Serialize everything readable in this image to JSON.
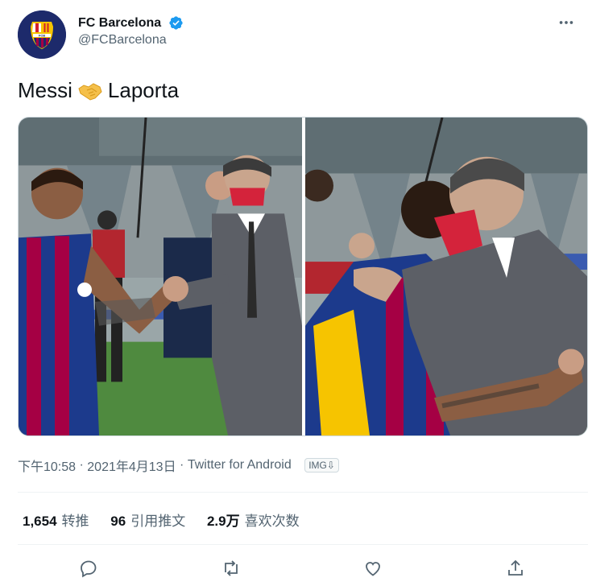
{
  "header": {
    "display_name": "FC Barcelona",
    "handle": "@FCBarcelona",
    "avatar_icon": "fc-barcelona-crest",
    "verified_icon": "verified-badge-icon",
    "more_icon": "more-horizontal-icon"
  },
  "tweet": {
    "text_before": "Messi",
    "emoji": "handshake",
    "text_after": "Laporta"
  },
  "media": {
    "photos": [
      {
        "name": "photo-handshake"
      },
      {
        "name": "photo-hug"
      }
    ]
  },
  "meta": {
    "time": "下午10:58",
    "separator1": "·",
    "date": "2021年4月13日",
    "separator2": "·",
    "source": "Twitter for Android",
    "img_badge": "IMG⇩"
  },
  "stats": [
    {
      "value": "1,654",
      "label": "转推"
    },
    {
      "value": "96",
      "label": "引用推文"
    },
    {
      "value": "2.9万",
      "label": "喜欢次数"
    }
  ],
  "actions": [
    {
      "icon": "reply-icon"
    },
    {
      "icon": "retweet-icon"
    },
    {
      "icon": "like-icon"
    },
    {
      "icon": "share-icon"
    }
  ],
  "colors": {
    "verified": "#1d9bf0",
    "secondary_text": "#536471",
    "barca_blue": "#1d2a6b",
    "barca_red": "#a50044"
  }
}
